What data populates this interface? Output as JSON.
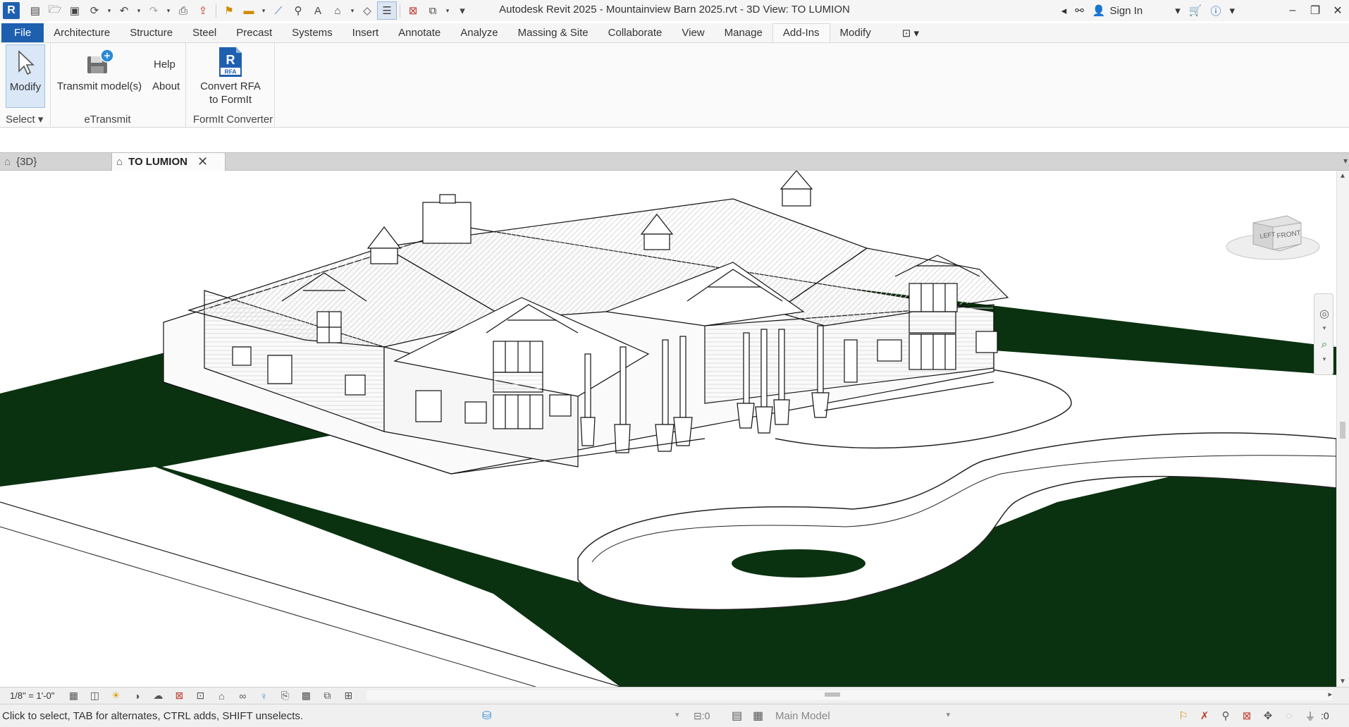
{
  "app": {
    "window_title": "Autodesk Revit 2025 - Mountainview Barn 2025.rvt - 3D View: TO LUMION",
    "logo_letter": "R",
    "sign_in_label": "Sign In"
  },
  "qat": {
    "icons": [
      "home-menu-icon",
      "open-icon",
      "save-icon",
      "sync-icon",
      "undo-icon",
      "redo-icon",
      "print-icon",
      "export-icon",
      "measure-icon",
      "align-icon",
      "tag-icon",
      "text-icon",
      "default-3d-icon",
      "sections-icon",
      "thin-lines-icon",
      "close-hidden-icon",
      "switch-windows-icon",
      "customize-icon"
    ]
  },
  "ribbon": {
    "tabs": [
      "File",
      "Architecture",
      "Structure",
      "Steel",
      "Precast",
      "Systems",
      "Insert",
      "Annotate",
      "Analyze",
      "Massing & Site",
      "Collaborate",
      "View",
      "Manage",
      "Add-Ins",
      "Modify"
    ],
    "active_tab": "Add-Ins",
    "panels": {
      "select": {
        "button_label": "Modify",
        "panel_label": "Select ▾"
      },
      "etransmit": {
        "button_label": "Transmit model(s)",
        "panel_label": "eTransmit"
      },
      "help": {
        "help_label": "Help",
        "about_label": "About"
      },
      "formit": {
        "button_label_line1": "Convert RFA",
        "button_label_line2": "to FormIt",
        "panel_label": "FormIt Converter",
        "icon_text": "RFA",
        "icon_letter": "R"
      }
    }
  },
  "view_tabs": [
    {
      "label": "{3D}",
      "icon": "home-3d-icon"
    },
    {
      "label": "TO LUMION",
      "icon": "home-3d-icon",
      "active": true
    }
  ],
  "viewcube": {
    "left_label": "LEFT",
    "front_label": "FRONT"
  },
  "view_control": {
    "scale": "1/8\" = 1'-0\""
  },
  "status": {
    "message": "Click to select, TAB for alternates, CTRL adds, SHIFT unselects.",
    "workset_count": ":0",
    "model_label": "Main Model",
    "filter_count": ":0"
  },
  "colors": {
    "accent": "#1e5fb0",
    "ground": "#0b3210",
    "ribbon_bg": "#fafafa",
    "tab_strip": "#d4d4d4"
  }
}
